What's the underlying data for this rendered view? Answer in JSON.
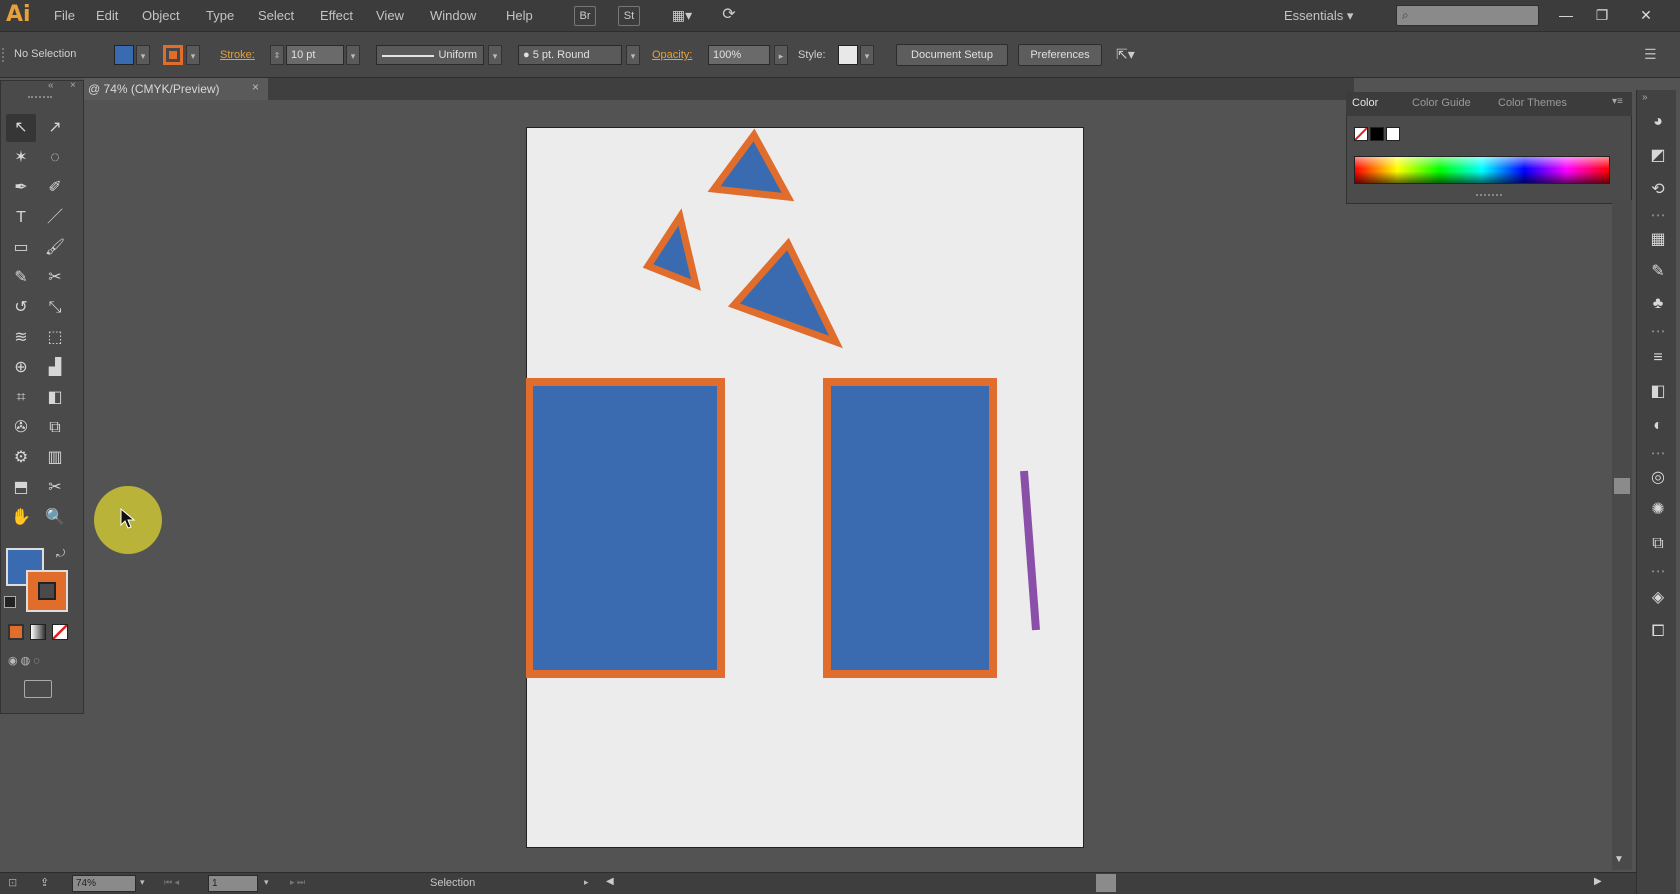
{
  "app": {
    "logo": "Ai"
  },
  "menu": [
    "File",
    "Edit",
    "Object",
    "Type",
    "Select",
    "Effect",
    "View",
    "Window",
    "Help"
  ],
  "menubar_icons": {
    "bridge": "Br",
    "stock": "St",
    "arrange": "▦▾",
    "sync": "⟳"
  },
  "workspace": {
    "label": "Essentials ▾"
  },
  "search": {
    "placeholder": "",
    "icon": "search-icon"
  },
  "window_controls": {
    "minimize": "—",
    "restore": "❐",
    "close": "✕"
  },
  "control_bar": {
    "selection": "No Selection",
    "stroke_label": "Stroke:",
    "stroke_weight": "10 pt",
    "profile": "Uniform",
    "brush": "5 pt. Round",
    "opacity_label": "Opacity:",
    "opacity": "100%",
    "style_label": "Style:",
    "document_setup": "Document Setup",
    "preferences": "Preferences"
  },
  "document": {
    "tab_title": "@ 74% (CMYK/Preview)",
    "close": "×"
  },
  "colors": {
    "fill": "#3a6ab0",
    "stroke": "#e06d2c",
    "purple_line": "#8a4fa8",
    "artboard": "#ececed",
    "accent": "#e8a03a"
  },
  "color_panel": {
    "tabs": [
      "Color",
      "Color Guide",
      "Color Themes"
    ],
    "active_tab": "Color"
  },
  "tools": [
    "selection-tool",
    "direct-selection-tool",
    "magic-wand-tool",
    "lasso-tool",
    "pen-tool",
    "curvature-tool",
    "type-tool",
    "line-segment-tool",
    "rectangle-tool",
    "paintbrush-tool",
    "pencil-tool",
    "scissors-tool",
    "rotate-tool",
    "scale-tool",
    "width-tool",
    "free-transform-tool",
    "shape-builder-tool",
    "perspective-grid-tool",
    "mesh-tool",
    "gradient-tool",
    "eyedropper-tool",
    "blend-tool",
    "symbol-sprayer-tool",
    "column-graph-tool",
    "artboard-tool",
    "slice-tool",
    "hand-tool",
    "zoom-tool"
  ],
  "tool_glyphs": [
    "↖",
    "↗",
    "✶",
    "◌",
    "✒",
    "✐",
    "T",
    "／",
    "▭",
    "🖌",
    "✎",
    "✂",
    "↺",
    "⤡",
    "≋",
    "⬚",
    "⊕",
    "▟",
    "⌗",
    "◧",
    "✇",
    "⧉",
    "⚙",
    "▥",
    "⬒",
    "✂",
    "✋",
    "🔍"
  ],
  "status": {
    "zoom": "74%",
    "page": "1",
    "tool": "Selection"
  }
}
